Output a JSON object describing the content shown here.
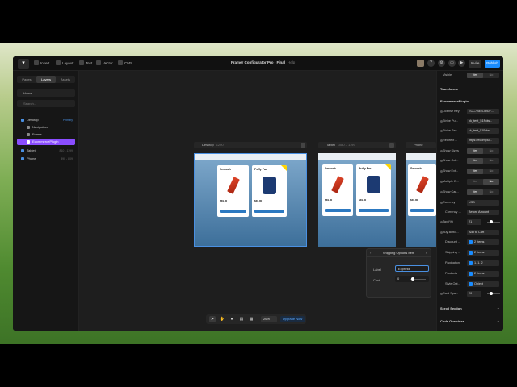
{
  "app": {
    "title": "Framer Configurator Pro - Final",
    "title_suffix": "Help",
    "toolbar_items": [
      "Insert",
      "Layout",
      "Text",
      "Vector",
      "CMS"
    ],
    "invite_label": "Invite",
    "publish_label": "Publish"
  },
  "left_panel": {
    "tabs": [
      "Pages",
      "Layers",
      "Assets"
    ],
    "active_tab": "Layers",
    "page_select": "Home",
    "search_placeholder": "Search...",
    "layers": [
      {
        "label": "Desktop",
        "aux": "Primary"
      },
      {
        "label": "Navigation",
        "aux": ""
      },
      {
        "label": "Frame",
        "aux": ""
      },
      {
        "label": "EcommercePlugin",
        "aux": ""
      },
      {
        "label": "Tablet",
        "aux": "810 - 1199"
      },
      {
        "label": "Phone",
        "aux": "390 - 809"
      }
    ]
  },
  "canvas": {
    "frames": [
      {
        "name": "Desktop",
        "dims": "1200"
      },
      {
        "name": "Tablet",
        "dims": "1080 – 1199"
      },
      {
        "name": "Phone",
        "dims": ""
      }
    ],
    "product_cards": [
      {
        "name": "Smooch",
        "price": "$39.00"
      },
      {
        "name": "Puffy Par",
        "price": "$39.00"
      }
    ]
  },
  "popup": {
    "title": "Shipping Options Item",
    "fields": [
      {
        "label": "Label",
        "value": "Express"
      },
      {
        "label": "Cost",
        "value": "0"
      }
    ]
  },
  "bottom_toolbar": {
    "zoom": "26%",
    "upgrade_label": "Upgrade Now"
  },
  "right_panel": {
    "visible": {
      "label": "Visible",
      "options": [
        "Yes",
        "No"
      ],
      "selected": "Yes"
    },
    "transforms_label": "Transforms",
    "plugin_header": "EcommercePlugin",
    "rows": [
      {
        "label": "License Key",
        "value": "ECC7BEB-0B07..."
      },
      {
        "label": "Stripe Pu...",
        "value": "pk_test_51Rdw..."
      },
      {
        "label": "Stripe Sec...",
        "value": "sk_test_51Rdw..."
      },
      {
        "label": "Redirect ...",
        "value": "https://ecomplu..."
      }
    ],
    "toggles": [
      {
        "label": "Show Sizes",
        "selected": "Yes"
      },
      {
        "label": "Show Col...",
        "selected": "Yes"
      },
      {
        "label": "Show Ext...",
        "selected": "Yes"
      },
      {
        "label": "Multiple E...",
        "selected": "No"
      },
      {
        "label": "Show Car...",
        "selected": "Yes"
      }
    ],
    "currency": {
      "label": "Currency",
      "value": "USD"
    },
    "currency_pos": {
      "label": "Currency ...",
      "value": "Before Amount"
    },
    "tax": {
      "label": "Tax (%)",
      "value": "21"
    },
    "buy_button": {
      "label": "Buy Butto...",
      "value": "Add to Cart"
    },
    "discount": {
      "label": "Discount ...",
      "value": "2 Items"
    },
    "shipping": {
      "label": "Shipping ...",
      "value": "2 Items"
    },
    "pagination": {
      "label": "Pagination",
      "value": "1, 1, 2"
    },
    "products": {
      "label": "Products",
      "value": "2 Items"
    },
    "style_opt": {
      "label": "Style Opt...",
      "value": "Object"
    },
    "card_spacing": {
      "label": "Card Spa...",
      "value": "20"
    },
    "scroll_section": "Scroll Section",
    "code_overrides": "Code Overrides"
  }
}
